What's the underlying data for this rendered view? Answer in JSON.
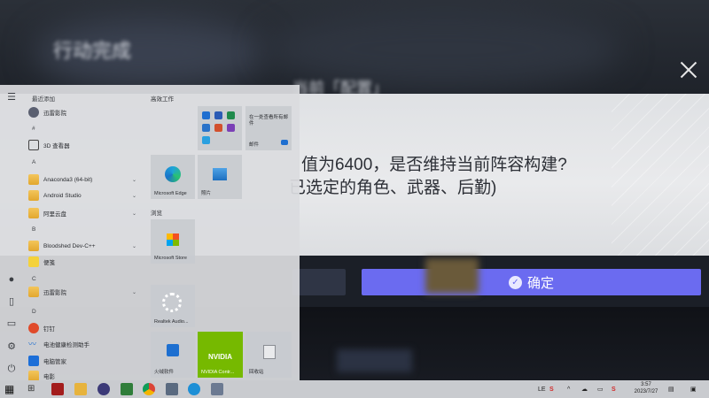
{
  "background": {
    "title": "行动完成",
    "subtitle": "当前「配置」",
    "dialog": {
      "line1": "值为6400，是否维持当前阵容构建?",
      "line2": "已选定的角色、武器、后勤)",
      "confirm_label": "确定"
    }
  },
  "start_menu": {
    "recent_header": "最近添加",
    "pinned_header": "高效工作",
    "browse_header": "浏览",
    "apps": [
      {
        "label": "迅雷影院",
        "icon": "avatar-icon"
      },
      {
        "label": "3D 查看器",
        "icon": "cube-icon"
      },
      {
        "label": "Anaconda3 (64-bit)",
        "icon": "folder-icon"
      },
      {
        "label": "Android Studio",
        "icon": "folder-icon"
      },
      {
        "label": "阿里云盘",
        "icon": "folder-icon"
      },
      {
        "label": "Bloodshed Dev-C++",
        "icon": "folder-icon"
      },
      {
        "label": "便笺",
        "icon": "sticky-notes-icon"
      },
      {
        "label": "迅雷影院",
        "icon": "folder-icon"
      },
      {
        "label": "钉钉",
        "icon": "dingtalk-icon"
      },
      {
        "label": "电池健康检测助手",
        "icon": "wave-icon"
      },
      {
        "label": "电脑管家",
        "icon": "manager-icon"
      },
      {
        "label": "电影",
        "icon": "folder-icon"
      }
    ],
    "letters": [
      "#",
      "A",
      "B",
      "C",
      "D"
    ],
    "tiles": {
      "office_label": "在一处查看所有邮件",
      "mail_label": "邮件",
      "edge_label": "Microsoft Edge",
      "photos_label": "照片",
      "store_label": "Microsoft Store",
      "realtek_label": "Realtek Audio...",
      "installer_label": "火绒软件",
      "nvidia_label": "NVIDIA Contr...",
      "recycle_label": "回收站"
    }
  },
  "taskbar": {
    "tray_lang": "LE",
    "tray_ime": "S",
    "time": "3:57",
    "date": "2023/7/27"
  }
}
